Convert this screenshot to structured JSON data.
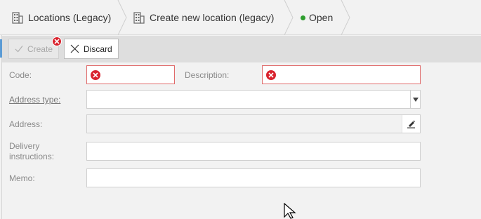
{
  "breadcrumbs": [
    {
      "label": "Locations (Legacy)",
      "icon": "building-icon"
    },
    {
      "label": "Create new location (legacy)",
      "icon": "building-icon"
    },
    {
      "label": "Open",
      "icon": "status-dot-icon"
    }
  ],
  "toolbar": {
    "create_label": "Create",
    "discard_label": "Discard"
  },
  "form": {
    "code_label": "Code:",
    "code_value": "",
    "description_label": "Description:",
    "description_value": "",
    "address_type_label": "Address type:",
    "address_type_value": "",
    "address_label": "Address:",
    "address_value": "",
    "delivery_label_line1": "Delivery",
    "delivery_label_line2": "instructions:",
    "delivery_value": "",
    "memo_label": "Memo:",
    "memo_value": ""
  },
  "colors": {
    "error": "#d9232e",
    "status_open": "#2e9e2e",
    "toolbar_bg": "#dedede"
  }
}
